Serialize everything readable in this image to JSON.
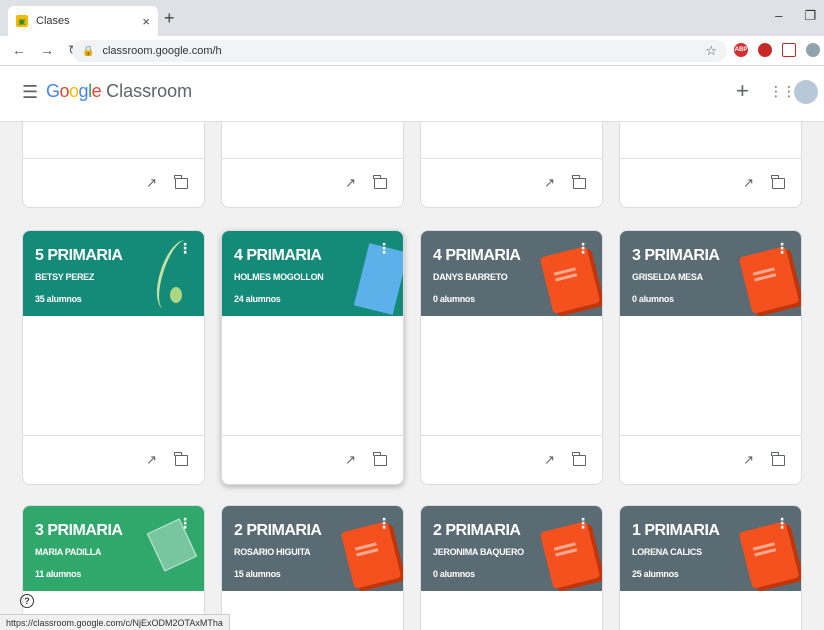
{
  "browser": {
    "tab_title": "Clases",
    "tab_close": "×",
    "new_tab": "+",
    "url": "classroom.google.com/h",
    "status_url": "https://classroom.google.com/c/NjExODM2OTAxMTha"
  },
  "app": {
    "logo_google": "Google",
    "logo_product": "Classroom",
    "create_label": "+",
    "apps_label": "⋮⋮⋮"
  },
  "colors": {
    "teal": "#148a78",
    "green": "#31a86b",
    "slate": "#5a6b73",
    "book": "#f4511e"
  },
  "top_cards": [
    {},
    {},
    {},
    {}
  ],
  "cards": [
    {
      "title": "5 PRIMARIA",
      "teacher": "BETSY PEREZ",
      "count": "35 alumnos",
      "theme": "teal",
      "art": "plant"
    },
    {
      "title": "4 PRIMARIA",
      "teacher": "HOLMES MOGOLLON",
      "count": "24 alumnos",
      "theme": "teal",
      "art": "ruler"
    },
    {
      "title": "4 PRIMARIA",
      "teacher": "DANYS BARRETO",
      "count": "0 alumnos",
      "theme": "slate",
      "art": "book"
    },
    {
      "title": "3 PRIMARIA",
      "teacher": "GRISELDA MESA",
      "count": "0 alumnos",
      "theme": "slate",
      "art": "book"
    },
    {
      "title": "3 PRIMARIA",
      "teacher": "MARIA PADILLA",
      "count": "11 alumnos",
      "theme": "green",
      "art": "prism"
    },
    {
      "title": "2 PRIMARIA",
      "teacher": "ROSARIO HIGUITA",
      "count": "15 alumnos",
      "theme": "slate",
      "art": "book"
    },
    {
      "title": "2 PRIMARIA",
      "teacher": "JERONIMA BAQUERO",
      "count": "0 alumnos",
      "theme": "slate",
      "art": "book"
    },
    {
      "title": "1 PRIMARIA",
      "teacher": "LORENA CALICS",
      "count": "25 alumnos",
      "theme": "slate",
      "art": "book"
    }
  ]
}
